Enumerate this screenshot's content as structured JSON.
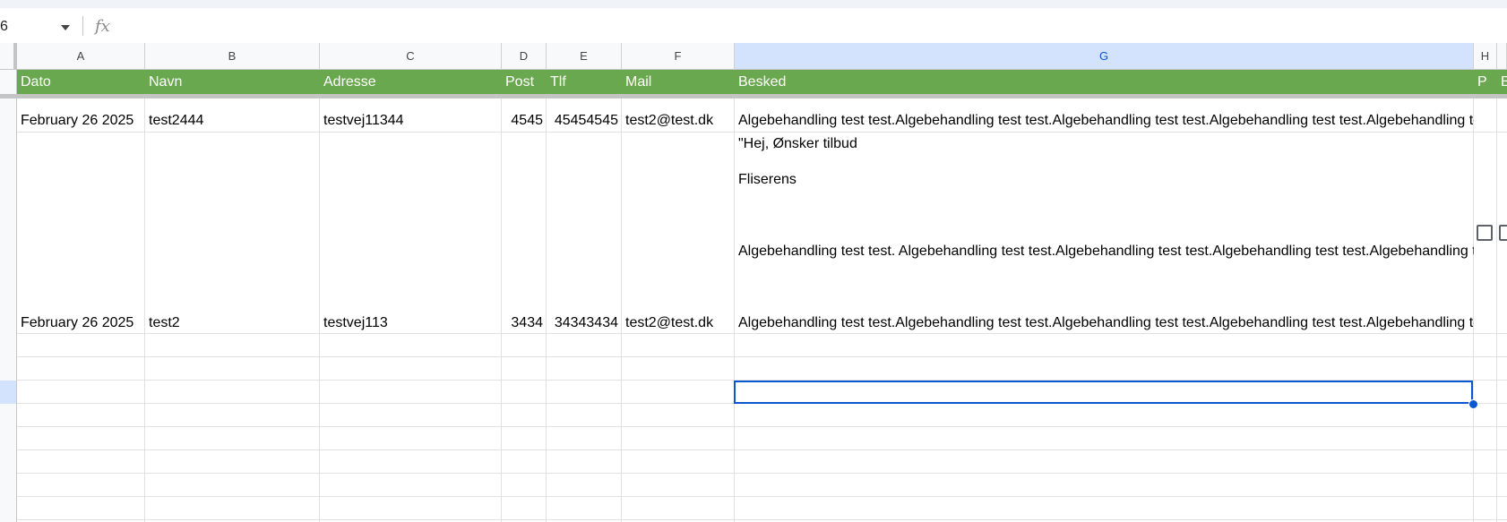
{
  "formula_bar": {
    "name_box": "6",
    "fx_label": "fx"
  },
  "columns": [
    "A",
    "B",
    "C",
    "D",
    "E",
    "F",
    "G",
    "H"
  ],
  "header_row": {
    "dato": "Dato",
    "navn": "Navn",
    "adresse": "Adresse",
    "post": "Post",
    "tlf": "Tlf",
    "mail": "Mail",
    "besked": "Besked",
    "h": "P",
    "i": "B"
  },
  "rows": [
    {
      "dato": "February 26 2025",
      "navn": "test2444",
      "adresse": "testvej11344",
      "post": "4545",
      "tlf": "45454545",
      "mail": "test2@test.dk",
      "besked": "Algebehandling test test.Algebehandling test test.Algebehandling test test.Algebehandling test test.Algebehandling test test."
    },
    {
      "dato": "February 26 2025",
      "navn": "test2",
      "adresse": "testvej113",
      "post": "3434",
      "tlf": "34343434",
      "mail": "test2@test.dk",
      "besked_line1": "\"Hej, Ønsker tilbud",
      "besked_line2": "Fliserens",
      "besked_line3": "Algebehandling test test. Algebehandling test test.Algebehandling test test.Algebehandling test test.Algebehandling test test.",
      "besked_line4": "Algebehandling test test.Algebehandling test test.Algebehandling test test.Algebehandling test test.Algebehandling test test."
    }
  ],
  "colors": {
    "header_green": "#6aa84f",
    "selection_blue": "#0b57d0",
    "selected_header_bg": "#d3e3fd"
  }
}
